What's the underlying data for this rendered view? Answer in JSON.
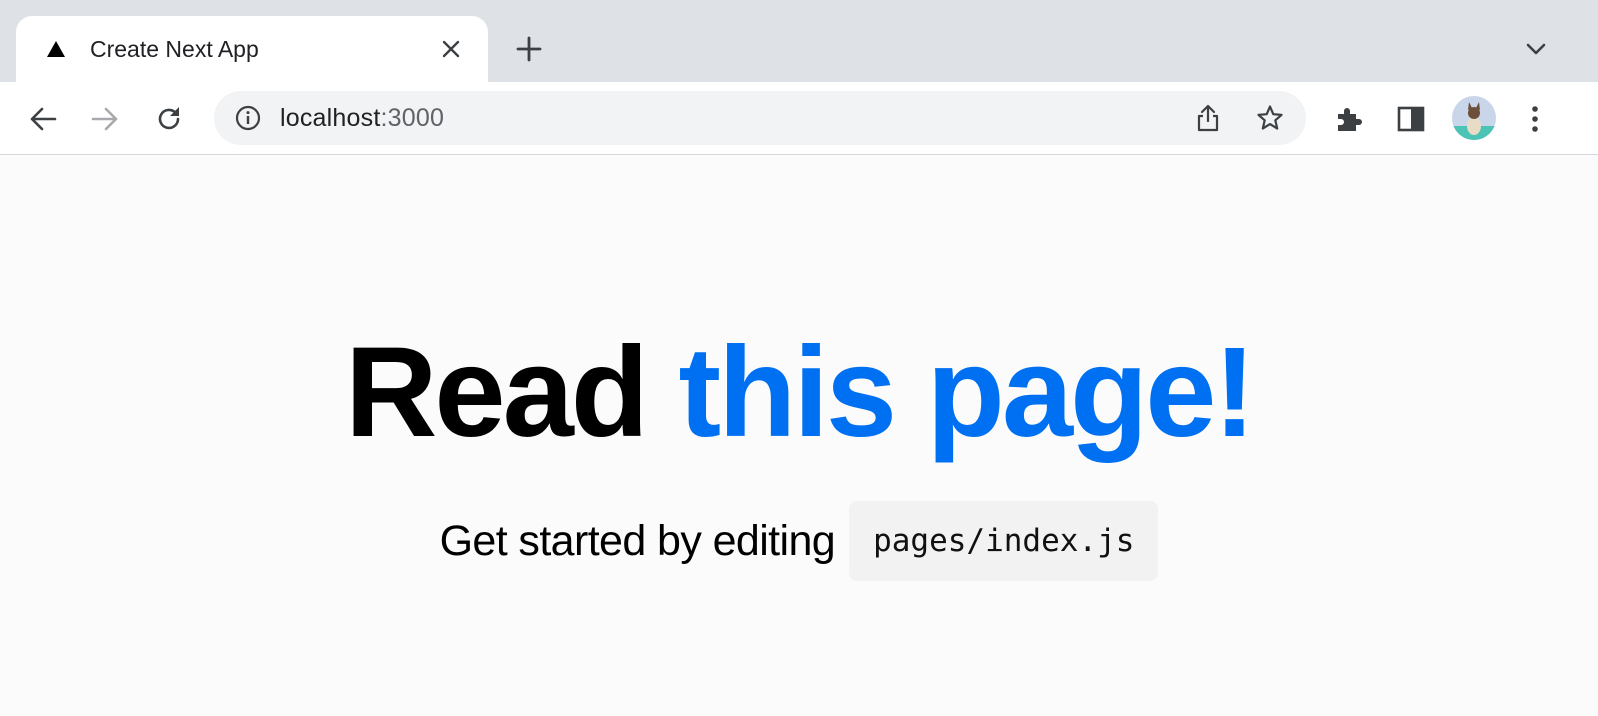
{
  "browser": {
    "tab": {
      "title": "Create Next App",
      "favicon_icon": "triangle-icon"
    },
    "new_tab_icon": "plus-icon",
    "tab_search_icon": "chevron-down-icon",
    "toolbar": {
      "back_icon": "arrow-left-icon",
      "forward_icon": "arrow-right-icon",
      "reload_icon": "reload-icon",
      "extensions_icon": "puzzle-icon",
      "side_panel_icon": "side-panel-icon",
      "menu_icon": "kebab-menu-icon"
    },
    "omnibox": {
      "host": "localhost",
      "port": ":3000",
      "info_icon": "info-icon",
      "share_icon": "share-icon",
      "bookmark_icon": "star-icon"
    }
  },
  "page": {
    "headline_prefix": "Read ",
    "headline_link": "this page!",
    "subline_text": "Get started by editing",
    "code": "pages/index.js"
  },
  "colors": {
    "link": "#0070f3",
    "tabstrip": "#dee1e6",
    "page_background": "#fbfbfb",
    "code_background": "#f2f2f2"
  }
}
